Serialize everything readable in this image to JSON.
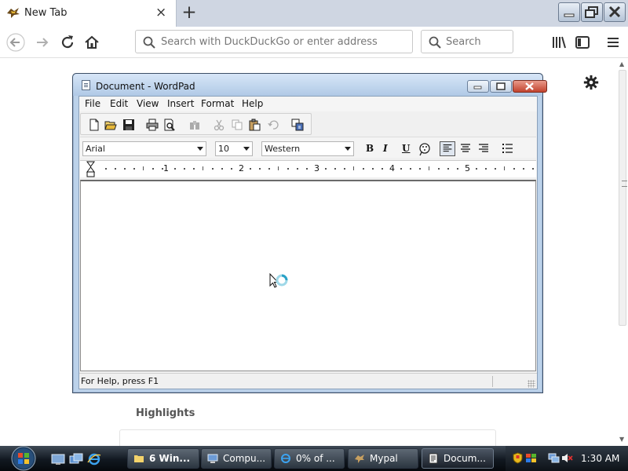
{
  "browser": {
    "tab_title": "New Tab",
    "tab_close": "×",
    "new_tab": "+",
    "address_placeholder": "Search with DuckDuckGo or enter address",
    "search_placeholder": "Search"
  },
  "newtab_page": {
    "highlights_label": "Highlights"
  },
  "wordpad": {
    "title": "Document - WordPad",
    "menu": [
      "File",
      "Edit",
      "View",
      "Insert",
      "Format",
      "Help"
    ],
    "font_name": "Arial",
    "font_size": "10",
    "script": "Western",
    "bold": "B",
    "italic": "I",
    "underline": "U",
    "ruler_numbers": [
      "1",
      "2",
      "3",
      "4",
      "5"
    ],
    "status_text": "For Help, press F1"
  },
  "taskbar": {
    "buttons": [
      {
        "label": "6 Win..."
      },
      {
        "label": "Compu..."
      },
      {
        "label": "0% of ..."
      },
      {
        "label": "Mypal"
      },
      {
        "label": "Docum..."
      }
    ],
    "clock": "1:30 AM"
  }
}
